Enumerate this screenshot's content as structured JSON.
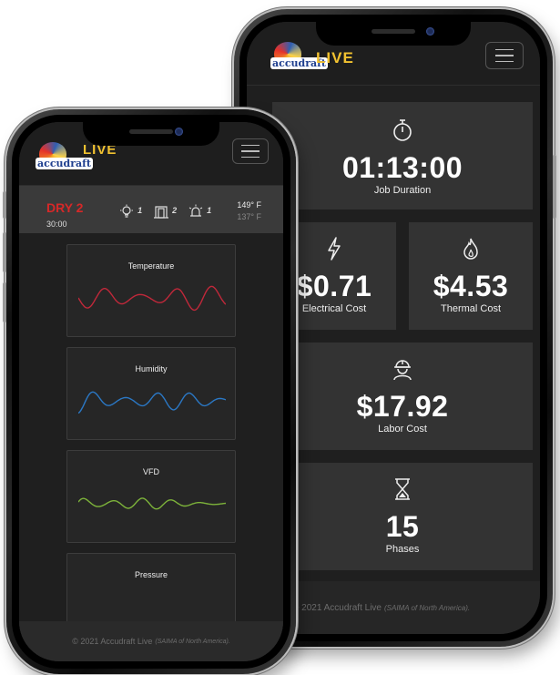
{
  "app": {
    "logo_text": "accudraft",
    "live_label": "LIVE",
    "menu_icon": "hamburger-icon"
  },
  "stats": {
    "job_duration": {
      "icon": "stopwatch-icon",
      "value": "01:13:00",
      "label": "Job Duration"
    },
    "electrical_cost": {
      "icon": "lightning-icon",
      "value": "$0.71",
      "label": "Electrical Cost"
    },
    "thermal_cost": {
      "icon": "flame-icon",
      "value": "$4.53",
      "label": "Thermal Cost"
    },
    "labor_cost": {
      "icon": "hard-hat-worker-icon",
      "value": "$17.92",
      "label": "Labor Cost"
    },
    "phases": {
      "icon": "hourglass-icon",
      "value": "15",
      "label": "Phases"
    }
  },
  "status": {
    "stage": "DRY 2",
    "time": "30:00",
    "sensors": [
      {
        "icon": "lightbulb-icon",
        "count": "1"
      },
      {
        "icon": "door-icon",
        "count": "2"
      },
      {
        "icon": "alarm-light-icon",
        "count": "1"
      }
    ],
    "temp_primary": "149° F",
    "temp_secondary": "137° F"
  },
  "charts": [
    {
      "title": "Temperature",
      "color": "#c0283a"
    },
    {
      "title": "Humidity",
      "color": "#2b78c5"
    },
    {
      "title": "VFD",
      "color": "#7db33a"
    },
    {
      "title": "Pressure",
      "color": "#d4a62a"
    }
  ],
  "footer": {
    "text": "© 2021 Accudraft Live",
    "note": "(SAIMA of North America)."
  }
}
